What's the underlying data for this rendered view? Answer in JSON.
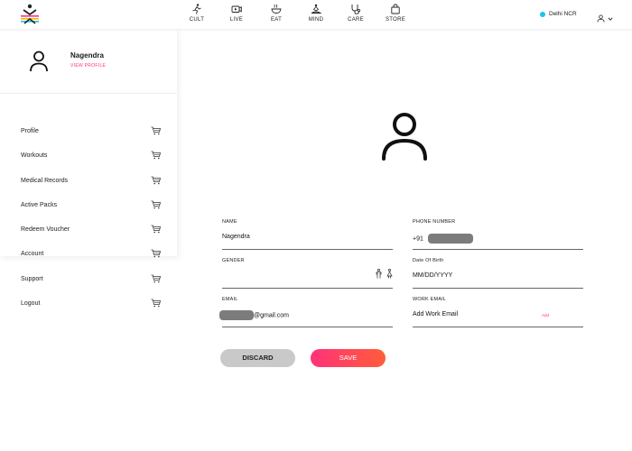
{
  "nav": {
    "items": [
      {
        "label": "CULT",
        "icon": "cult-runner-icon"
      },
      {
        "label": "LIVE",
        "icon": "live-video-icon"
      },
      {
        "label": "EAT",
        "icon": "eat-bowl-icon"
      },
      {
        "label": "MIND",
        "icon": "mind-meditation-icon"
      },
      {
        "label": "CARE",
        "icon": "care-stethoscope-icon"
      },
      {
        "label": "STORE",
        "icon": "store-bag-icon"
      }
    ],
    "location": "Delhi NCR",
    "location_dot_color": "#1ec4e6"
  },
  "profile": {
    "name": "Nagendra",
    "view_profile": "VIEW PROFILE"
  },
  "sidebar": {
    "items": [
      {
        "label": "Profile"
      },
      {
        "label": "Workouts"
      },
      {
        "label": "Medical Records"
      },
      {
        "label": "Active Packs"
      },
      {
        "label": "Redeem Voucher"
      },
      {
        "label": "Account"
      },
      {
        "label": "Support"
      },
      {
        "label": "Logout"
      }
    ]
  },
  "form": {
    "name": {
      "label": "NAME",
      "value": "Nagendra"
    },
    "phone": {
      "label": "PHONE NUMBER",
      "prefix": "+91"
    },
    "gender": {
      "label": "GENDER"
    },
    "dob": {
      "label": "Date Of Birth",
      "value": "MM/DD/YYYY"
    },
    "email": {
      "label": "EMAIL",
      "suffix": "@gmail.com"
    },
    "work_email": {
      "label": "WORK EMAIL",
      "value": "Add Work Email",
      "action": "Add"
    }
  },
  "buttons": {
    "discard": "DISCARD",
    "save": "SAVE"
  },
  "colors": {
    "accent": "#ff3278",
    "save_gradient_end": "#ff5d3b",
    "discard_bg": "#c9c9c9"
  }
}
